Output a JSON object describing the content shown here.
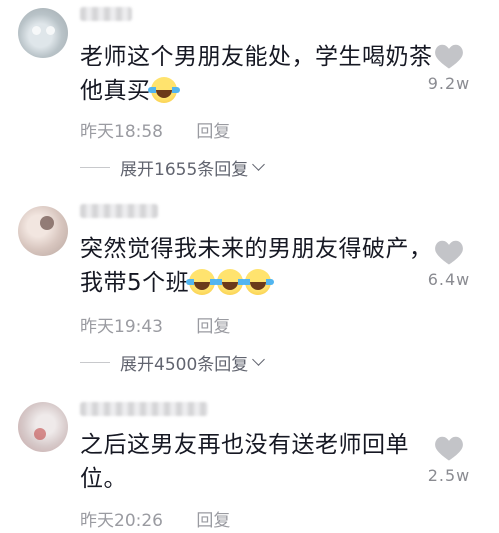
{
  "comments": [
    {
      "text_line1": "老师这个男朋友能处，学生喝奶茶",
      "text_line2": "他真买",
      "emoji_count": 1,
      "time": "昨天18:58",
      "reply_label": "回复",
      "expand_label": "展开1655条回复",
      "likes": "9.2w"
    },
    {
      "text_line1": "突然觉得我未来的男朋友得破产，",
      "text_line2": "我带5个班",
      "emoji_count": 3,
      "time": "昨天19:43",
      "reply_label": "回复",
      "expand_label": "展开4500条回复",
      "likes": "6.4w"
    },
    {
      "text_line1": "之后这男友再也没有送老师回单",
      "text_line2": "位。",
      "emoji_count": 0,
      "time": "昨天20:26",
      "reply_label": "回复",
      "likes": "2.5w"
    }
  ],
  "icons": {
    "like": "heart-icon",
    "expand": "chevron-down-icon",
    "emoji": "laughing-crying-emoji-icon"
  },
  "colors": {
    "text": "#161823",
    "meta": "#9a9ba1",
    "heart": "#c3c4c8"
  }
}
